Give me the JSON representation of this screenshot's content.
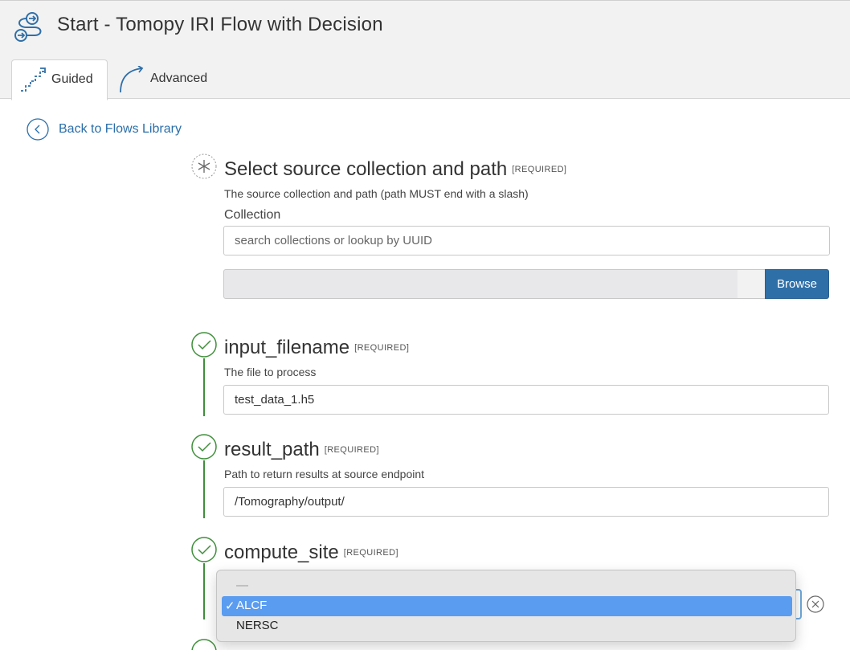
{
  "header": {
    "title": "Start - Tomopy IRI Flow with Decision",
    "icon": "flow-icon"
  },
  "tabs": [
    {
      "label": "Guided",
      "icon": "stairs-icon",
      "active": true
    },
    {
      "label": "Advanced",
      "icon": "curve-arrow-icon",
      "active": false
    }
  ],
  "back_link": {
    "label": "Back to Flows Library"
  },
  "required_tag": "[REQUIRED]",
  "steps": {
    "source": {
      "title": "Select source collection and path",
      "description": "The source collection and path (path MUST end with a slash)",
      "collection_label": "Collection",
      "collection_placeholder": "search collections or lookup by UUID",
      "path_value": "",
      "browse_label": "Browse"
    },
    "input_filename": {
      "title": "input_filename",
      "description": "The file to process",
      "value": "test_data_1.h5"
    },
    "result_path": {
      "title": "result_path",
      "description": "Path to return results at source endpoint",
      "value": "/Tomography/output/"
    },
    "compute_site": {
      "title": "compute_site",
      "options": [
        "—",
        "ALCF",
        "NERSC"
      ],
      "selected": "ALCF",
      "check_mark": "✓"
    }
  },
  "colors": {
    "accent_blue": "#2f6fa8",
    "link_blue": "#2a6ea9",
    "success_green": "#3f8f3a",
    "selected_option": "#5a9cf0"
  }
}
